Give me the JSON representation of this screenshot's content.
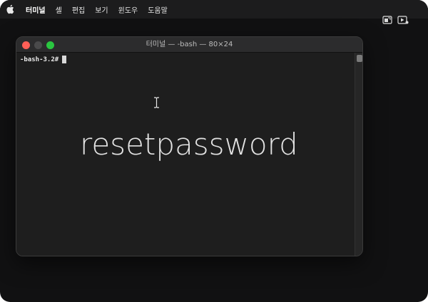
{
  "menubar": {
    "app_name": "터미널",
    "items": [
      "셸",
      "편집",
      "보기",
      "윈도우",
      "도움말"
    ],
    "icon": "apple-icon"
  },
  "controls": {
    "icons": [
      "screen-mirror-icon",
      "video-play-icon"
    ]
  },
  "terminal": {
    "title": "터미널 — -bash — 80×24",
    "prompt": "-bash-3.2#",
    "overlay_command": "resetpassword"
  },
  "colors": {
    "close": "#ff5f57",
    "minimize": "#4a4a4b",
    "maximize": "#2ac640",
    "background": "#111112",
    "terminal_bg": "#1e1e1e"
  }
}
